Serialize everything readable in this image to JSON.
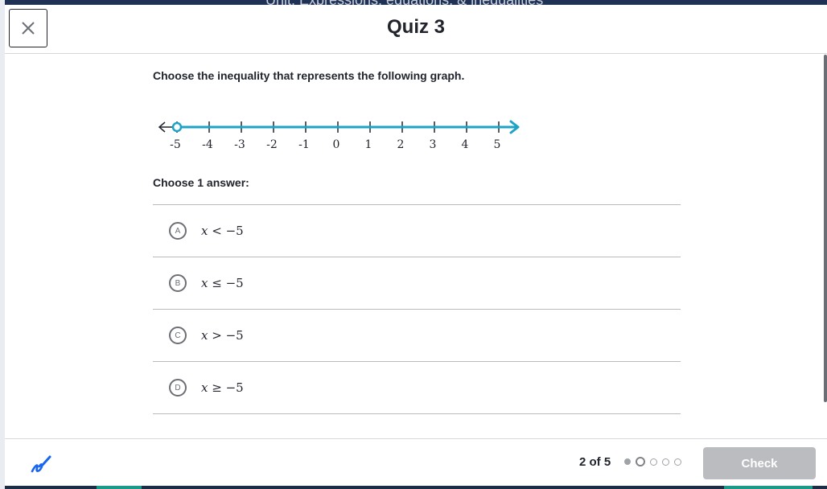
{
  "background": {
    "unit_title": "Unit: Expressions, equations, & inequalities"
  },
  "header": {
    "title": "Quiz 3",
    "close_icon": "close-icon"
  },
  "question": {
    "prompt": "Choose the inequality that represents the following graph.",
    "number_line": {
      "min": -5,
      "max": 5,
      "tick_labels": [
        "-5",
        "-4",
        "-3",
        "-2",
        "-1",
        "0",
        "1",
        "2",
        "3",
        "4",
        "5"
      ],
      "point": -5,
      "point_style": "open",
      "direction": "right",
      "ray_color": "#1ea3c6"
    },
    "choose_label": "Choose 1 answer:",
    "choices": [
      {
        "letter": "A",
        "var": "x",
        "op": " < ",
        "rhs": "−5"
      },
      {
        "letter": "B",
        "var": "x",
        "op": " ≤ ",
        "rhs": "−5"
      },
      {
        "letter": "C",
        "var": "x",
        "op": " > ",
        "rhs": "−5"
      },
      {
        "letter": "D",
        "var": "x",
        "op": " ≥ ",
        "rhs": "−5"
      }
    ]
  },
  "footer": {
    "scratchpad_icon": "scratchpad-icon",
    "progress_text": "2 of 5",
    "progress": {
      "current": 2,
      "total": 5
    },
    "check_label": "Check",
    "check_enabled": false
  }
}
